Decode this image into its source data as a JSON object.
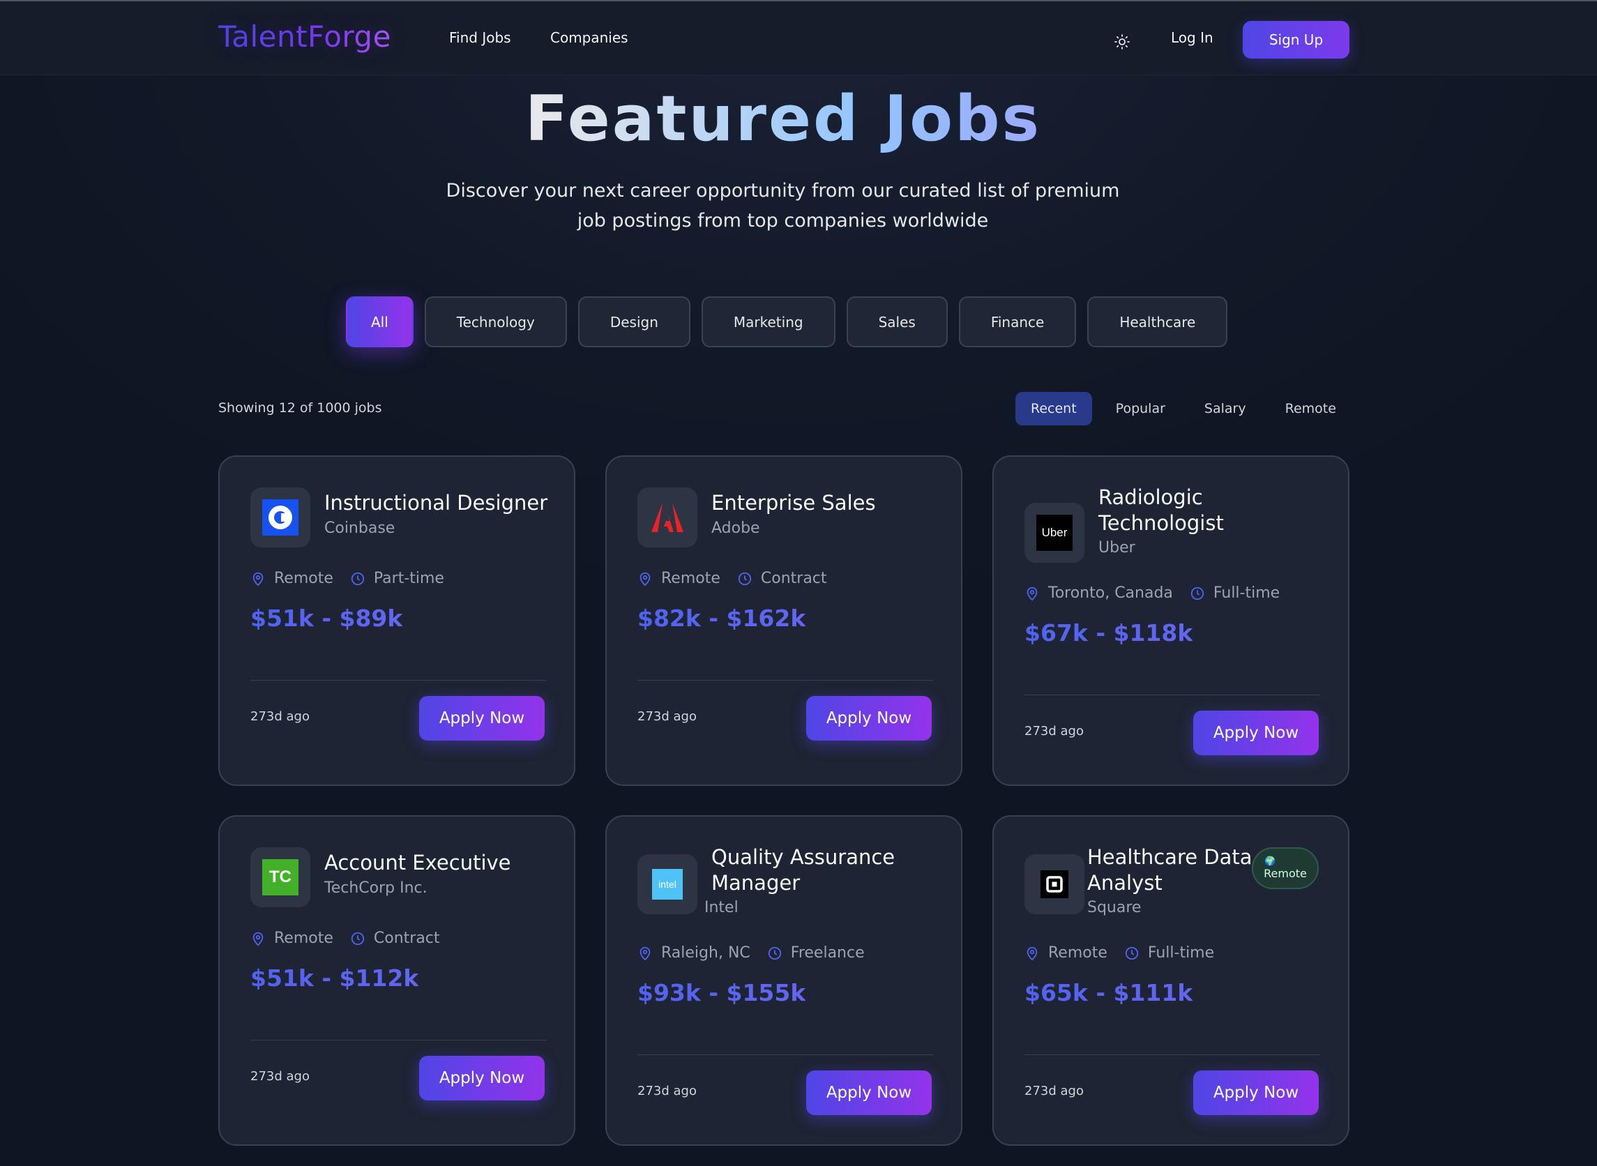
{
  "brand": {
    "name": "TalentForge"
  },
  "nav": {
    "find_jobs": "Find Jobs",
    "companies": "Companies",
    "login": "Log In",
    "signup": "Sign Up"
  },
  "hero": {
    "title": "Featured Jobs",
    "subtitle_line1": "Discover your next career opportunity from our curated list of premium",
    "subtitle_line2": "job postings from top companies worldwide"
  },
  "filters": [
    "All",
    "Technology",
    "Design",
    "Marketing",
    "Sales",
    "Finance",
    "Healthcare"
  ],
  "active_filter": "All",
  "results": {
    "count_text": "Showing 12 of 1000 jobs"
  },
  "sort_options": [
    "Recent",
    "Popular",
    "Salary",
    "Remote"
  ],
  "active_sort": "Recent",
  "jobs": [
    {
      "title": "Instructional Designer",
      "company": "Coinbase",
      "location": "Remote",
      "type": "Part-time",
      "salary": "$51k - $89k",
      "posted": "273d ago",
      "apply": "Apply Now",
      "logo_icon": "coinbase-logo"
    },
    {
      "title": "Enterprise Sales",
      "company": "Adobe",
      "location": "Remote",
      "type": "Contract",
      "salary": "$82k - $162k",
      "posted": "273d ago",
      "apply": "Apply Now",
      "logo_icon": "adobe-logo"
    },
    {
      "title": "Radiologic Technologist",
      "company": "Uber",
      "location": "Toronto, Canada",
      "type": "Full-time",
      "salary": "$67k - $118k",
      "posted": "273d ago",
      "apply": "Apply Now",
      "logo_icon": "uber-logo",
      "logo_text": "Uber"
    },
    {
      "title": "Account Executive",
      "company": "TechCorp Inc.",
      "location": "Remote",
      "type": "Contract",
      "salary": "$51k - $112k",
      "posted": "273d ago",
      "apply": "Apply Now",
      "logo_icon": "techcrunch-logo",
      "logo_text": "TC"
    },
    {
      "title": "Quality Assurance Manager",
      "company": "Intel",
      "location": "Raleigh, NC",
      "type": "Freelance",
      "salary": "$93k - $155k",
      "posted": "273d ago",
      "apply": "Apply Now",
      "logo_icon": "intel-logo",
      "logo_text": "intel"
    },
    {
      "title": "Healthcare Data Analyst",
      "company": "Square",
      "location": "Remote",
      "type": "Full-time",
      "salary": "$65k - $111k",
      "posted": "273d ago",
      "apply": "Apply Now",
      "logo_icon": "square-logo",
      "badge": "Remote"
    }
  ],
  "colors": {
    "accent": "#4f46e5",
    "accent2": "#9333ea",
    "background": "#111827",
    "card": "#1e2433"
  }
}
